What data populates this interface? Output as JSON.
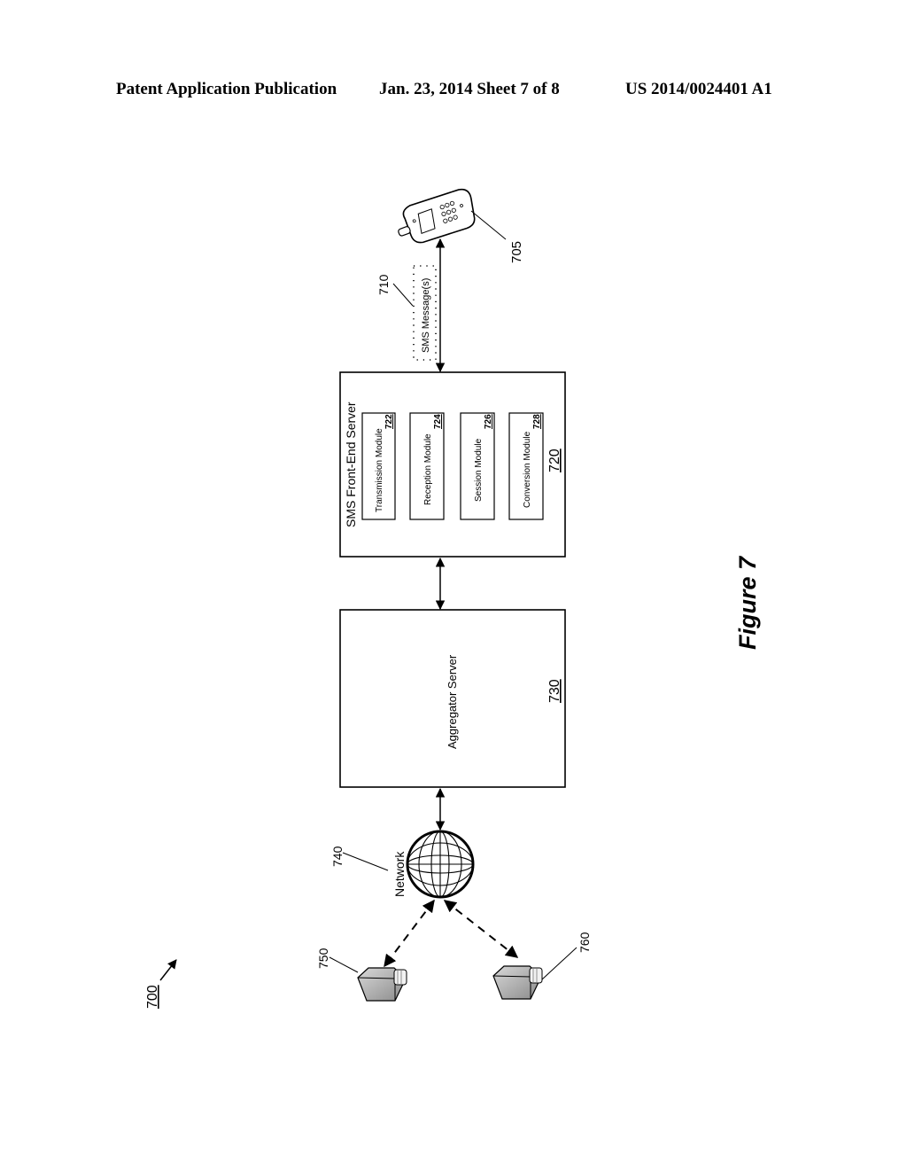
{
  "header": {
    "left": "Patent Application Publication",
    "middle": "Jan. 23, 2014   Sheet 7 of 8",
    "right": "US 2014/0024401 A1"
  },
  "figure": {
    "caption": "Figure 7",
    "system_ref": "700",
    "phone": {
      "ref": "705",
      "icon": "mobile-phone-icon"
    },
    "sms_messages": {
      "label": "SMS Message(s)",
      "ref": "710"
    },
    "sms_server": {
      "title": "SMS Front-End Server",
      "ref": "720",
      "modules": [
        {
          "name": "Transmission Module",
          "ref": "722"
        },
        {
          "name": "Reception Module",
          "ref": "724"
        },
        {
          "name": "Session Module",
          "ref": "726"
        },
        {
          "name": "Conversion Module",
          "ref": "728"
        }
      ]
    },
    "aggregator": {
      "title": "Aggregator Server",
      "ref": "730"
    },
    "network": {
      "label": "Network",
      "ref": "740",
      "icon": "globe-icon"
    },
    "servers": [
      {
        "ref": "750",
        "icon": "server-icon"
      },
      {
        "ref": "760",
        "icon": "server-icon"
      }
    ]
  }
}
